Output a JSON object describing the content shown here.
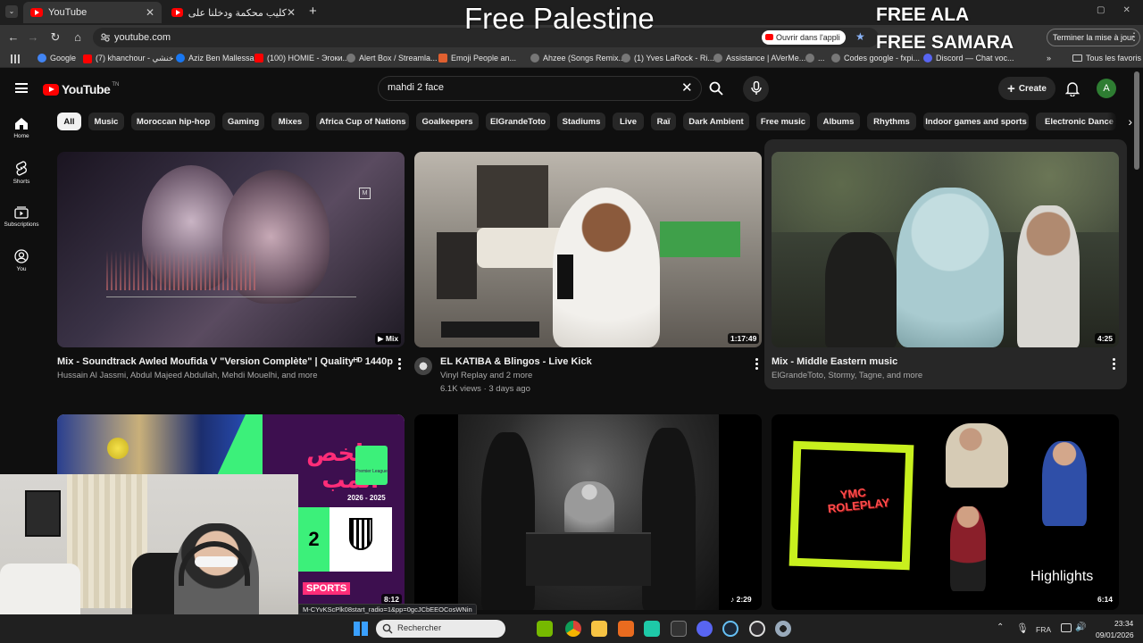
{
  "browser": {
    "tabs": [
      {
        "label": "YouTube",
        "active": true
      },
      {
        "label": "كليب محكمة ودخلنا على المقومة",
        "active": false
      }
    ],
    "url": "youtube.com",
    "open_app_label": "Ouvrir dans l'appli",
    "update_label": "Terminer la mise à jour",
    "all_bookmarks_label": "Tous les favoris",
    "bookmarks": [
      {
        "label": "Google",
        "color": "#4285f4"
      },
      {
        "label": "(7) khanchour - خنشي",
        "color": "#ff0000"
      },
      {
        "label": "Aziz Ben Mallessa",
        "color": "#1877f2"
      },
      {
        "label": "(100) HOMIE - Эгоки...",
        "color": "#ff0000"
      },
      {
        "label": "Alert Box / Streamla...",
        "color": "#888888"
      },
      {
        "label": "Emoji People an...",
        "color": "#e06030"
      },
      {
        "label": "Ahzee (Songs Remix...",
        "color": "#888888"
      },
      {
        "label": "(1) Yves LaRock - Ri...",
        "color": "#888888"
      },
      {
        "label": "Assistance | AVerMe...",
        "color": "#888888"
      },
      {
        "label": "...",
        "color": "#888888"
      },
      {
        "label": "Codes google - fxpi...",
        "color": "#888888"
      },
      {
        "label": "Discord — Chat voc...",
        "color": "#5865f2"
      }
    ]
  },
  "overlay": {
    "center_text": "Free Palestine",
    "right_line1": "FREE ALA",
    "right_line2": "FREE SAMARA"
  },
  "header": {
    "logo_text": "YouTube",
    "logo_sup": "TN",
    "search_value": "mahdi 2 face",
    "create_label": "Create",
    "avatar_letter": "A"
  },
  "sidebar": [
    {
      "label": "Home",
      "icon": "home-icon"
    },
    {
      "label": "Shorts",
      "icon": "shorts-icon"
    },
    {
      "label": "Subscriptions",
      "icon": "subscriptions-icon"
    },
    {
      "label": "You",
      "icon": "you-icon"
    }
  ],
  "chips": [
    "All",
    "Music",
    "Moroccan hip-hop",
    "Gaming",
    "Mixes",
    "Africa Cup of Nations",
    "Goalkeepers",
    "ElGrandeToto",
    "Stadiums",
    "Live",
    "Raï",
    "Dark Ambient",
    "Free music",
    "Albums",
    "Rhythms",
    "Indoor games and sports",
    "Electronic Dance"
  ],
  "videos": [
    {
      "title": "Mix - Soundtrack Awled Moufida V \"Version Complète\"  | Qualityᴴᴰ 1440p",
      "meta1": "Hussain Al Jassmi, Abdul Majeed Abdullah, Mehdi Mouelhi, and more",
      "meta2": "",
      "badge": "Mix"
    },
    {
      "title": "EL KATIBA & Blingos - Live Kick",
      "meta1": "Vinyl Replay and 2 more",
      "meta2": "6.1K views · 3 days ago",
      "badge": "1:17:49"
    },
    {
      "title": "Mix - Middle Eastern music",
      "meta1": "ElGrandeToto, Stormy, Tagne, and more",
      "meta2": "",
      "badge": "4:25"
    },
    {
      "badge": "8:12",
      "thumb_text_ar": "ملخص المب",
      "thumb_season": "2026 - 2025",
      "thumb_league": "Premier League",
      "thumb_score": "2",
      "thumb_brand": "SPORTS"
    },
    {
      "badge": "2:29"
    },
    {
      "badge": "6:14",
      "thumb_logo": "YMC ROLEPLAY",
      "thumb_caption": "Highlights"
    }
  ],
  "status_url": "M-CYvKScPlk08start_radio=1&pp=0gcJCbEEOCosWNin",
  "taskbar": {
    "search_placeholder": "Rechercher",
    "lang": "FRA",
    "time": "23:34",
    "date": "09/01/2026"
  }
}
